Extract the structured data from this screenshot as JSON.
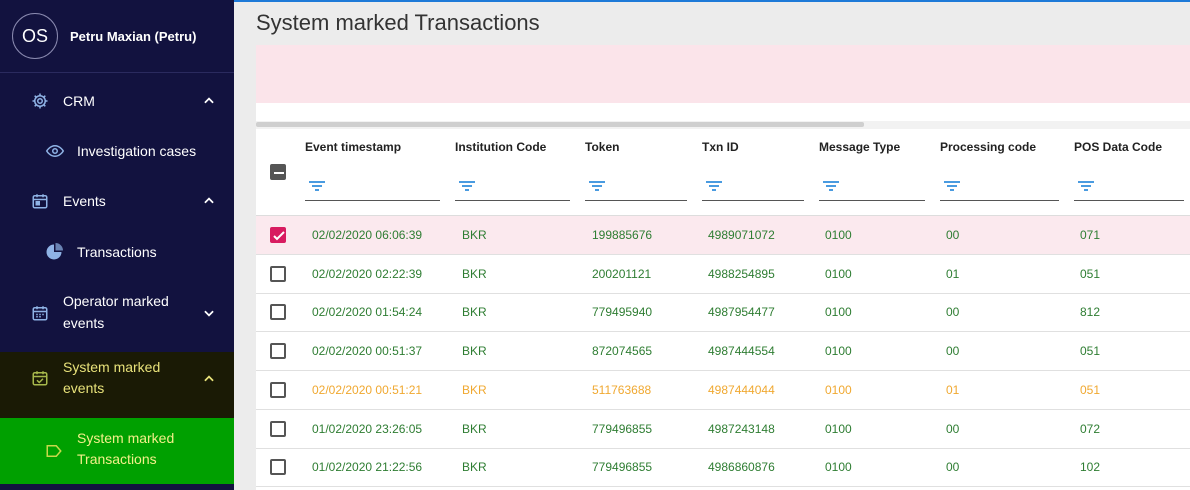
{
  "user": {
    "initials": "OS",
    "name": "Petru Maxian (Petru)"
  },
  "sidebar": {
    "items": [
      {
        "label": "CRM",
        "icon": "gear-icon",
        "expanded": true
      },
      {
        "label": "Investigation cases",
        "icon": "eye-icon"
      },
      {
        "label": "Events",
        "icon": "calendar-icon",
        "expanded": true
      },
      {
        "label": "Transactions",
        "icon": "pie-chart-icon"
      },
      {
        "label_line1": "Operator marked",
        "label_line2": "events",
        "icon": "calendar-grid-icon",
        "expanded": false
      },
      {
        "label_line1": "System marked",
        "label_line2": "events",
        "icon": "calendar-check-icon",
        "expanded": true
      },
      {
        "label_line1": "System marked",
        "label_line2": "Transactions",
        "icon": "label-icon"
      }
    ]
  },
  "page": {
    "title": "System marked Transactions"
  },
  "table": {
    "columns": [
      "Event timestamp",
      "Institution Code",
      "Token",
      "Txn ID",
      "Message Type",
      "Processing code",
      "POS Data Code"
    ],
    "rows": [
      {
        "checked": true,
        "highlight": "pink",
        "cells": [
          "02/02/2020 06:06:39",
          "BKR",
          "199885676",
          "4989071072",
          "0100",
          "00",
          "071"
        ]
      },
      {
        "checked": false,
        "cells": [
          "02/02/2020 02:22:39",
          "BKR",
          "200201121",
          "4988254895",
          "0100",
          "01",
          "051"
        ]
      },
      {
        "checked": false,
        "cells": [
          "02/02/2020 01:54:24",
          "BKR",
          "779495940",
          "4987954477",
          "0100",
          "00",
          "812"
        ]
      },
      {
        "checked": false,
        "cells": [
          "02/02/2020 00:51:37",
          "BKR",
          "872074565",
          "4987444554",
          "0100",
          "00",
          "051"
        ]
      },
      {
        "checked": false,
        "highlight": "orange",
        "cells": [
          "02/02/2020 00:51:21",
          "BKR",
          "511763688",
          "4987444044",
          "0100",
          "01",
          "051"
        ]
      },
      {
        "checked": false,
        "cells": [
          "01/02/2020 23:26:05",
          "BKR",
          "779496855",
          "4987243148",
          "0100",
          "00",
          "072"
        ]
      },
      {
        "checked": false,
        "cells": [
          "01/02/2020 21:22:56",
          "BKR",
          "779496855",
          "4986860876",
          "0100",
          "00",
          "102"
        ]
      }
    ]
  },
  "colors": {
    "sidebar_bg": "#12123f",
    "active_group_bg": "#1a1a05",
    "active_item_bg": "#00a000",
    "active_text": "#e8e27a",
    "row_text": "#2e7d32",
    "row_warn": "#f0a830",
    "check": "#d81b60",
    "alert_bg": "#fbe4ea",
    "accent": "#1e7ad8"
  }
}
